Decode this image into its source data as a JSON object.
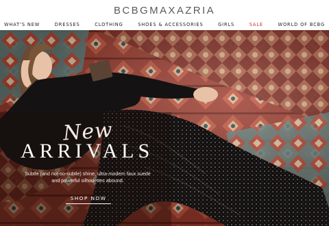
{
  "brand": {
    "logo_text": "BCBGMAXAZRIA"
  },
  "nav": {
    "items": [
      {
        "label": "WHAT'S NEW"
      },
      {
        "label": "DRESSES"
      },
      {
        "label": "CLOTHING"
      },
      {
        "label": "SHOES & ACCESSORIES"
      },
      {
        "label": "GIRLS"
      },
      {
        "label": "SALE"
      },
      {
        "label": "WORLD OF BCBG"
      }
    ]
  },
  "hero": {
    "headline_script": "New",
    "headline_main": "ARRIVALS",
    "subtitle_line1": "Subtle (and not-so-subtle) shine, ultra-modern faux suede",
    "subtitle_line2": "and powerful silhouettes abound.",
    "cta_label": "SHOP NOW"
  },
  "colors": {
    "sale": "#c62d3a",
    "rug_red": "#a3372a",
    "rug_teal": "#6e8f8a",
    "dress": "#141213"
  }
}
